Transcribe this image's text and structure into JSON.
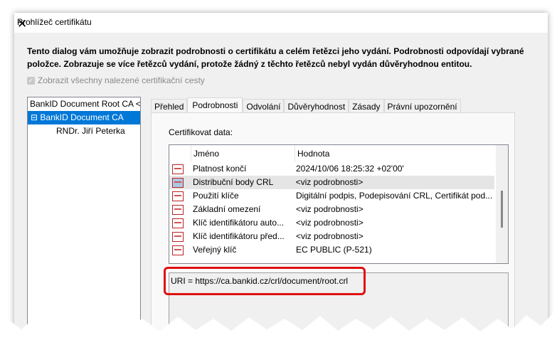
{
  "window": {
    "title": "Prohlížeč certifikátu",
    "close": "✕"
  },
  "description": "Tento dialog vám umožňuje zobrazit podrobnosti o certifikátu a celém řetězci jeho vydání. Podrobnosti odpovídají vybrané položce. Zobrazuje se více řetězců vydání, protože žádný z těchto řetězců nebyl vydán důvěryhodnou entitou.",
  "checkbox": {
    "label": "Zobrazit všechny nalezené certifikační cesty",
    "checked": true
  },
  "tree": [
    "BankID Document Root CA <",
    "BankID Document CA",
    "RNDr. Jiří Peterka"
  ],
  "tabs": [
    "Přehled",
    "Podrobnosti",
    "Odvolání",
    "Důvěryhodnost",
    "Zásady",
    "Právní upozornění"
  ],
  "panel": {
    "label": "Certifikovat data:",
    "columns": [
      "Jméno",
      "Hodnota"
    ],
    "rows": [
      [
        "Platnost končí",
        "2024/10/06 18:25:32 +02'00'"
      ],
      [
        "Distribuční body CRL",
        "<viz podrobnosti>"
      ],
      [
        "Použití klíče",
        "Digitální podpis, Podepisování CRL, Certifikát pod..."
      ],
      [
        "Základní omezení",
        "<viz podrobnosti>"
      ],
      [
        "Klíč identifikátoru auto...",
        "<viz podrobnosti>"
      ],
      [
        "Klíč identifikátoru před...",
        "<viz podrobnosti>"
      ],
      [
        "Veřejný klíč",
        "EC PUBLIC (P-521)"
      ]
    ],
    "detail": "URI = https://ca.bankid.cz/crl/document/root.crl"
  }
}
